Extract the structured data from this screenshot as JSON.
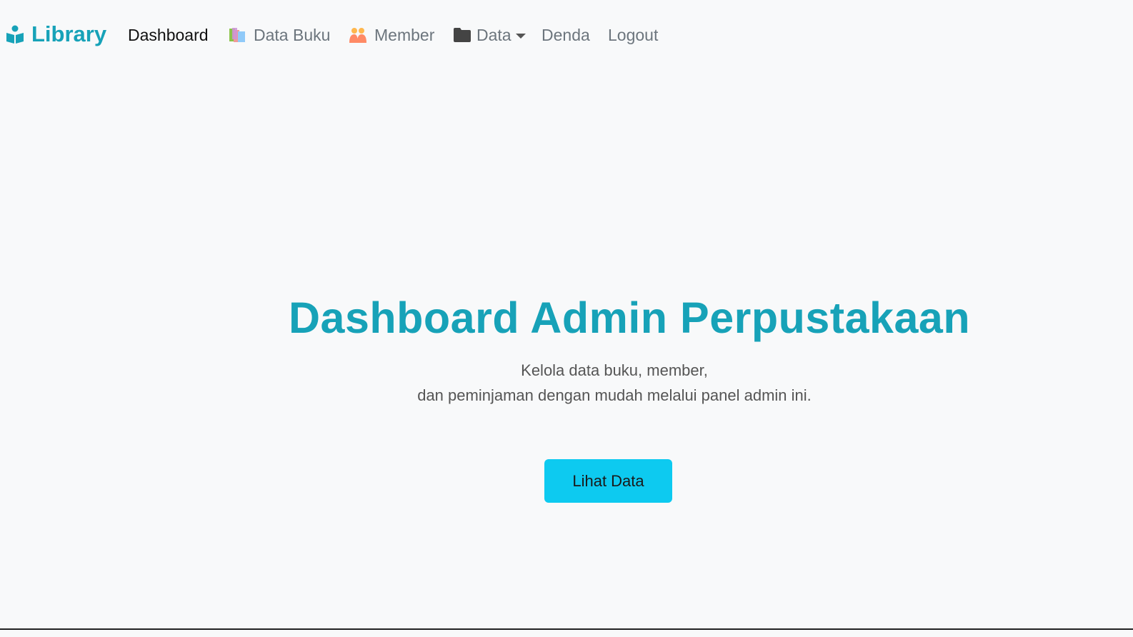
{
  "navbar": {
    "brand": {
      "label": "Library",
      "icon": "book-reader-icon",
      "color": "#17a2b8"
    },
    "items": [
      {
        "label": "Dashboard",
        "active": true
      },
      {
        "label": "Data Buku",
        "icon": "books-icon"
      },
      {
        "label": "Member",
        "icon": "people-icon"
      },
      {
        "label": "Data",
        "icon": "folder-icon",
        "dropdown": true
      },
      {
        "label": "Denda"
      },
      {
        "label": "Logout"
      }
    ]
  },
  "hero": {
    "title": "Dashboard Admin Perpustakaan",
    "subtitle_line1": "Kelola data buku, member,",
    "subtitle_line2": "dan peminjaman dengan mudah melalui panel admin ini.",
    "button_label": "Lihat Data",
    "title_color": "#17a2b8",
    "button_color": "#0dcaf0"
  }
}
